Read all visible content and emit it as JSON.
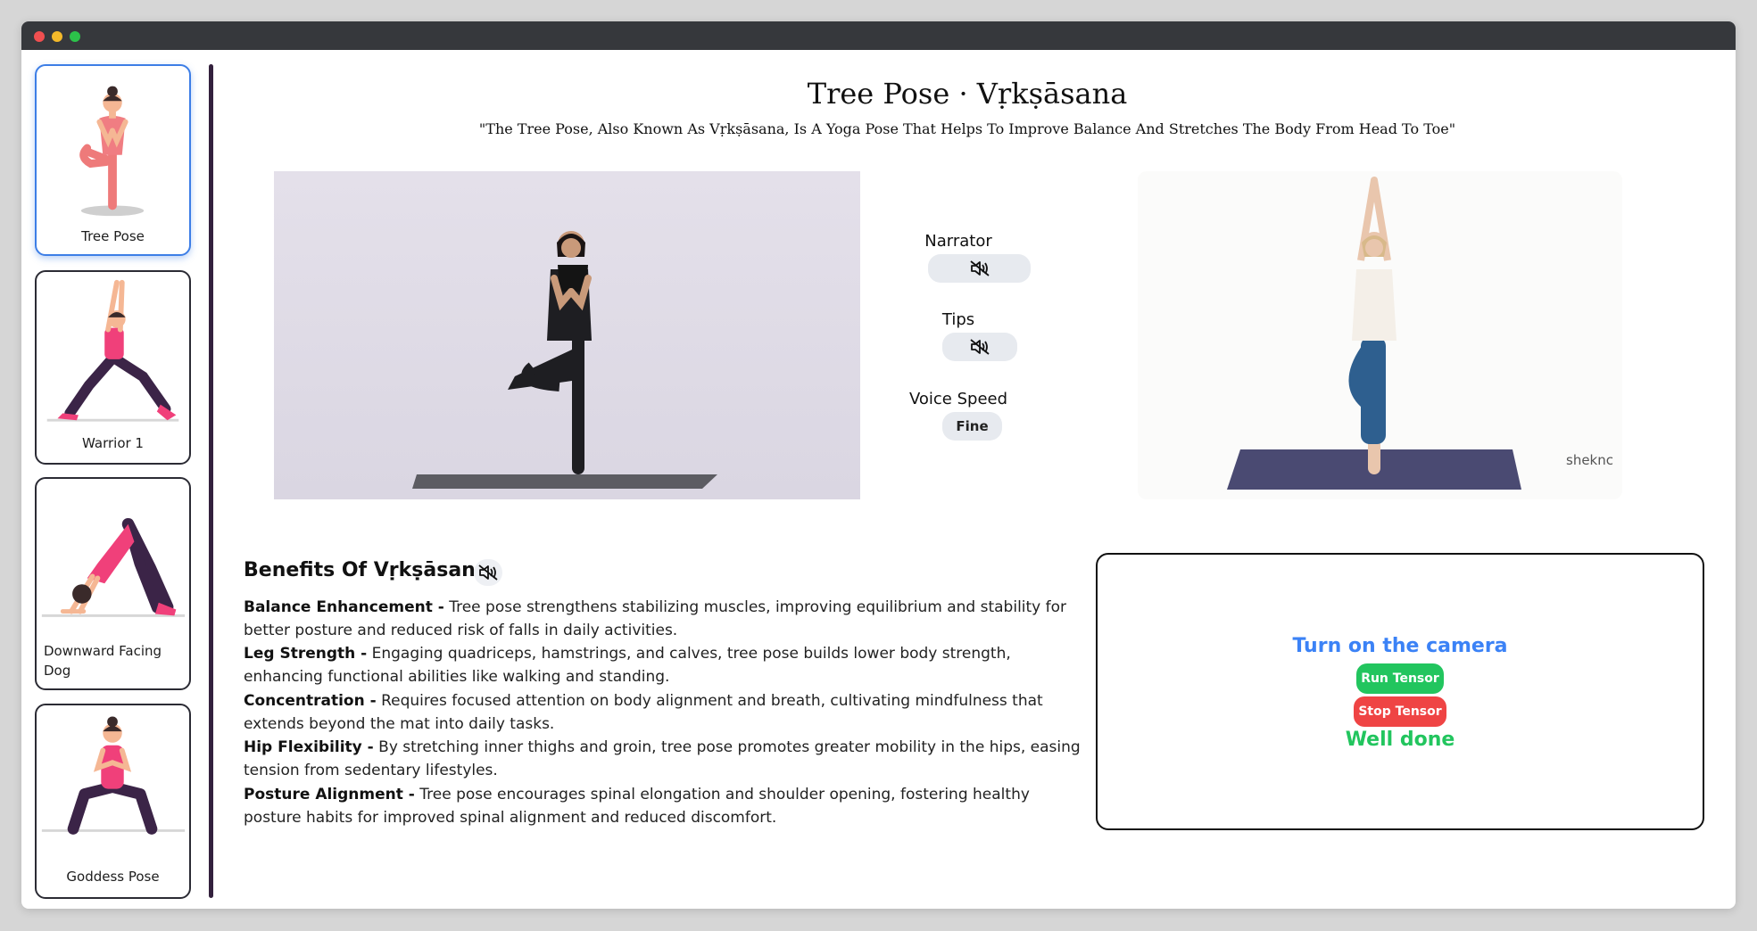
{
  "window": {
    "controls": [
      "close",
      "minimize",
      "maximize"
    ]
  },
  "sidebar": {
    "items": [
      {
        "label": "Tree Pose",
        "active": true,
        "icon": "tree-pose-illustration"
      },
      {
        "label": "Warrior 1",
        "active": false,
        "icon": "warrior-pose-illustration"
      },
      {
        "label": "Downward Facing Dog",
        "active": false,
        "icon": "downward-dog-illustration"
      },
      {
        "label": "Goddess Pose",
        "active": false,
        "icon": "goddess-pose-illustration"
      }
    ]
  },
  "header": {
    "title": "Tree Pose · Vṛkṣāsana",
    "subtitle": "\"The Tree Pose, Also Known As Vṛkṣāsana, Is A Yoga Pose That Helps To Improve Balance And Stretches The Body From Head To Toe\""
  },
  "media": {
    "right_watermark": "sheknc"
  },
  "controls": {
    "narrator": {
      "label": "Narrator",
      "icon": "speaker-muted-icon"
    },
    "tips": {
      "label": "Tips",
      "icon": "speaker-muted-icon"
    },
    "voice_speed": {
      "label": "Voice Speed",
      "value": "Fine"
    }
  },
  "benefits": {
    "title": "Benefits Of Vṛkṣāsana",
    "icon": "speaker-muted-icon",
    "items": [
      {
        "name": "Balance Enhancement -",
        "text": "Tree pose strengthens stabilizing muscles, improving equilibrium and stability for better posture and reduced risk of falls in daily activities."
      },
      {
        "name": "Leg Strength -",
        "text": "Engaging quadriceps, hamstrings, and calves, tree pose builds lower body strength, enhancing functional abilities like walking and standing."
      },
      {
        "name": "Concentration -",
        "text": "Requires focused attention on body alignment and breath, cultivating mindfulness that extends beyond the mat into daily tasks."
      },
      {
        "name": "Hip Flexibility -",
        "text": "By stretching inner thighs and groin, tree pose promotes greater mobility in the hips, easing tension from sedentary lifestyles."
      },
      {
        "name": "Posture Alignment -",
        "text": "Tree pose encourages spinal elongation and shoulder opening, fostering healthy posture habits for improved spinal alignment and reduced discomfort."
      }
    ]
  },
  "camera": {
    "title": "Turn on the camera",
    "run_label": "Run Tensor",
    "stop_label": "Stop Tensor",
    "status": "Well done"
  },
  "colors": {
    "accent_blue": "#3b82f6",
    "success_green": "#22c55e",
    "danger_red": "#ef4444",
    "divider": "#33213d"
  }
}
